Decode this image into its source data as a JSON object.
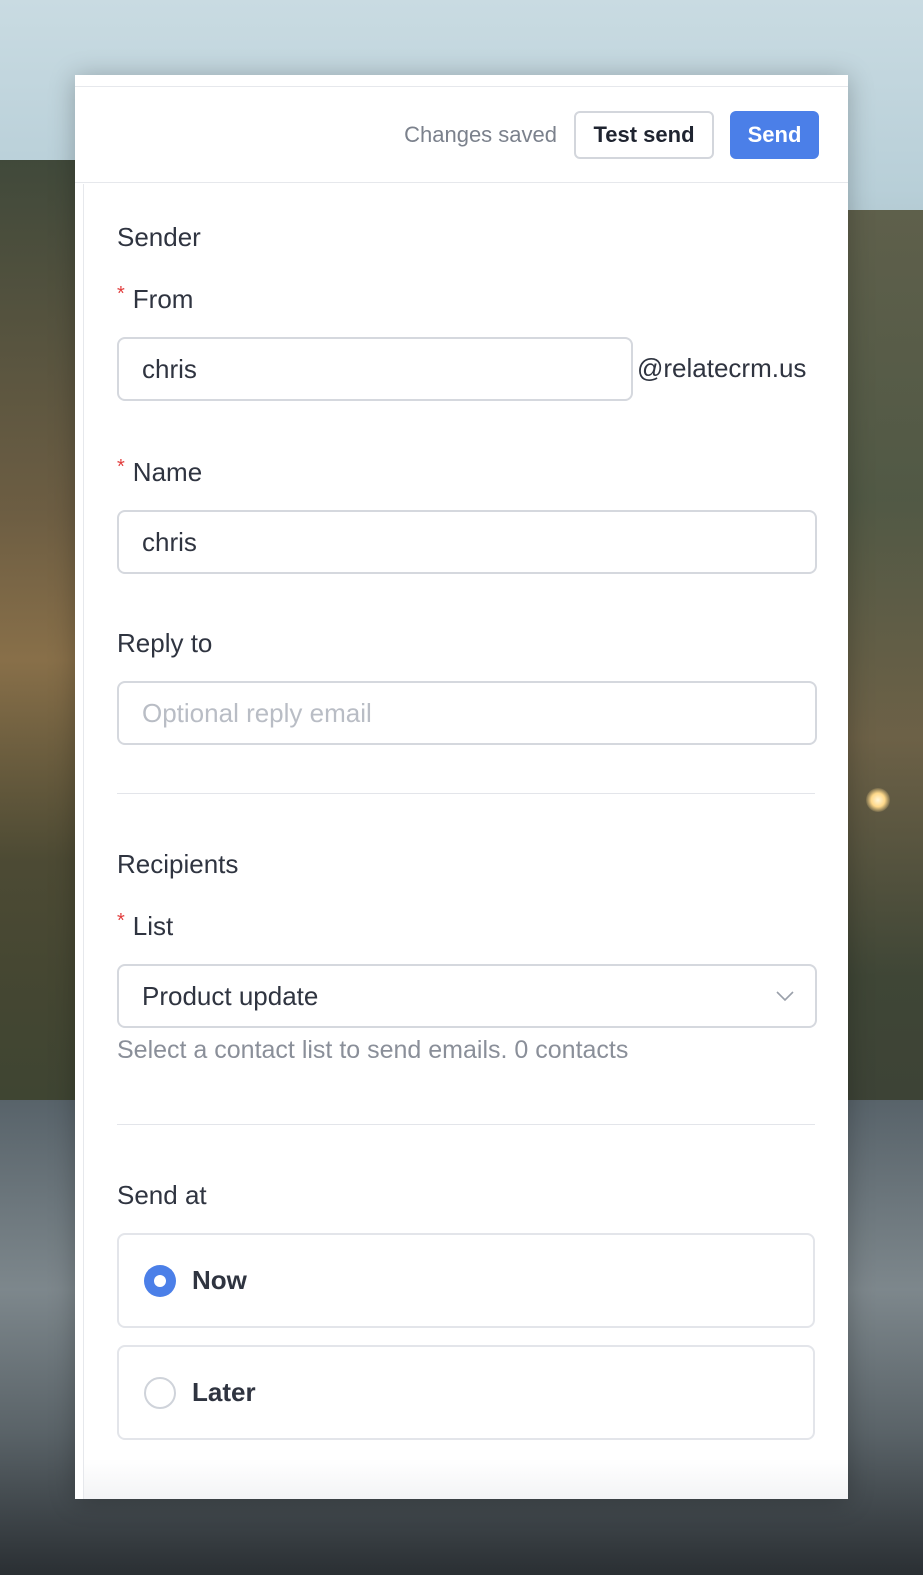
{
  "toolbar": {
    "status": "Changes saved",
    "test_send_label": "Test send",
    "send_label": "Send"
  },
  "sender": {
    "title": "Sender",
    "from": {
      "required": "*",
      "label": "From",
      "value": "chris",
      "suffix": "@relatecrm.us"
    },
    "name": {
      "required": "*",
      "label": "Name",
      "value": "chris"
    },
    "reply_to": {
      "label": "Reply to",
      "value": "",
      "placeholder": "Optional reply email"
    }
  },
  "recipients": {
    "title": "Recipients",
    "list": {
      "required": "*",
      "label": "List",
      "selected": "Product update",
      "help": "Select a contact list to send emails. 0 contacts"
    }
  },
  "send_at": {
    "title": "Send at",
    "options": [
      {
        "label": "Now",
        "checked": true
      },
      {
        "label": "Later",
        "checked": false
      }
    ]
  },
  "colors": {
    "primary": "#4b7fe8",
    "required": "#e23d3d"
  }
}
